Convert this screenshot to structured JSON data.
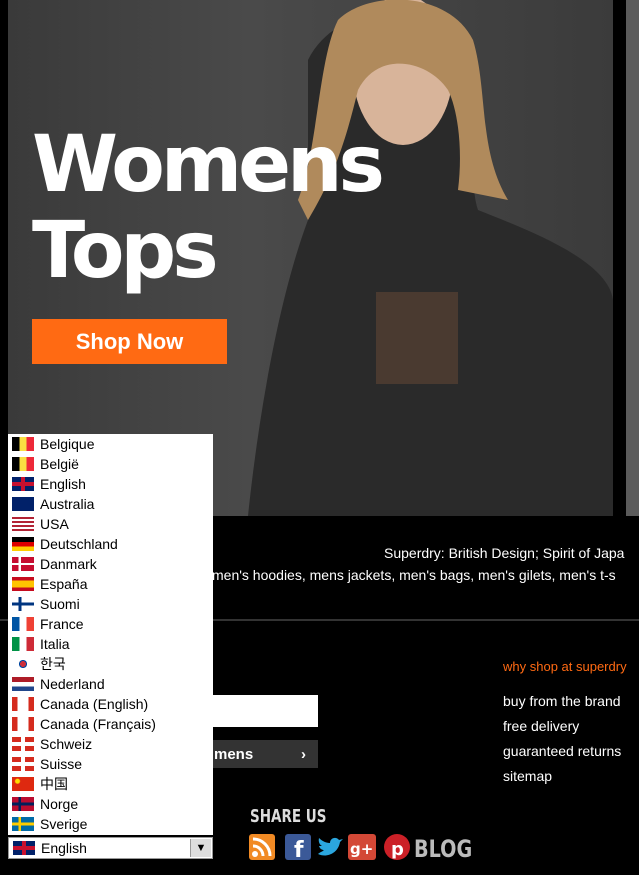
{
  "hero": {
    "title_line1": "Womens",
    "title_line2": "Tops",
    "cta": "Shop Now"
  },
  "footer": {
    "strapline": "Superdry: British Design; Spirit of Japa",
    "keywords": "men's hoodies, mens jackets, men's bags, men's gilets, men's t-s",
    "gender_button": "mens",
    "gender_arrow": "›",
    "why_title": "why shop at superdry",
    "why_links": [
      "buy from the brand",
      "free delivery",
      "guaranteed returns",
      "sitemap"
    ],
    "share_title": "SHARE US",
    "blog_label": "BLOG",
    "social_icons": [
      "rss-icon",
      "facebook-icon",
      "twitter-icon",
      "google-plus-icon",
      "pinterest-icon"
    ]
  },
  "language_selector": {
    "selected": "English",
    "options": [
      {
        "label": "Belgique",
        "flag": "belgium-flag-icon"
      },
      {
        "label": "België",
        "flag": "belgium-flag-icon"
      },
      {
        "label": "English",
        "flag": "uk-flag-icon"
      },
      {
        "label": "Australia",
        "flag": "australia-flag-icon"
      },
      {
        "label": "USA",
        "flag": "usa-flag-icon"
      },
      {
        "label": "Deutschland",
        "flag": "germany-flag-icon"
      },
      {
        "label": "Danmark",
        "flag": "denmark-flag-icon"
      },
      {
        "label": "España",
        "flag": "spain-flag-icon"
      },
      {
        "label": "Suomi",
        "flag": "finland-flag-icon"
      },
      {
        "label": "France",
        "flag": "france-flag-icon"
      },
      {
        "label": "Italia",
        "flag": "italy-flag-icon"
      },
      {
        "label": "한국",
        "flag": "korea-flag-icon"
      },
      {
        "label": "Nederland",
        "flag": "netherlands-flag-icon"
      },
      {
        "label": "Canada (English)",
        "flag": "canada-flag-icon"
      },
      {
        "label": "Canada (Français)",
        "flag": "canada-flag-icon"
      },
      {
        "label": "Schweiz",
        "flag": "switzerland-flag-icon"
      },
      {
        "label": "Suisse",
        "flag": "switzerland-flag-icon"
      },
      {
        "label": "中国",
        "flag": "china-flag-icon"
      },
      {
        "label": "Norge",
        "flag": "norway-flag-icon"
      },
      {
        "label": "Sverige",
        "flag": "sweden-flag-icon"
      }
    ]
  },
  "colors": {
    "accent": "#ff6a13",
    "background": "#000000"
  }
}
